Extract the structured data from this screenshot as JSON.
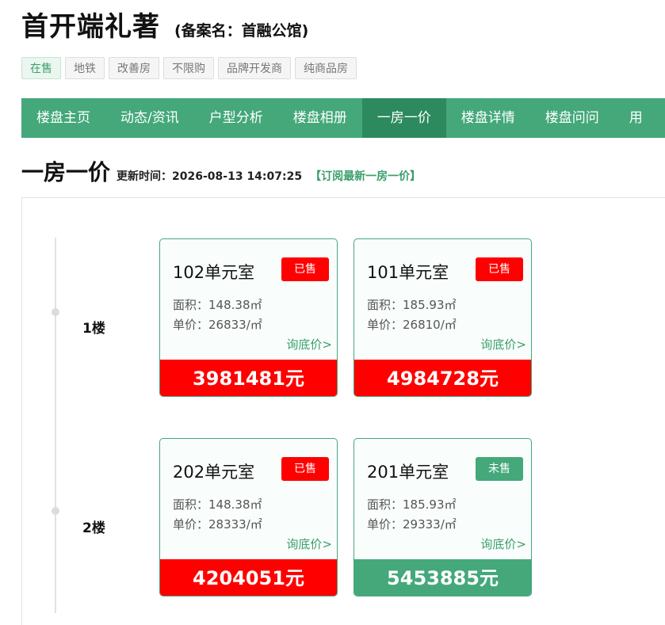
{
  "header": {
    "title": "首开端礼著",
    "record_name": "(备案名：首融公馆)"
  },
  "tags": [
    "在售",
    "地铁",
    "改善房",
    "不限购",
    "品牌开发商",
    "纯商品房"
  ],
  "nav": {
    "items": [
      "楼盘主页",
      "动态/资讯",
      "户型分析",
      "楼盘相册",
      "一房一价",
      "楼盘详情",
      "楼盘问问",
      "用"
    ],
    "active": "一房一价"
  },
  "section": {
    "title": "一房一价",
    "update": "更新时间：2026-08-13 14:07:25",
    "subscribe": "【订阅最新一房一价】"
  },
  "floors": [
    {
      "label": "1楼",
      "units": [
        {
          "name": "102单元室",
          "status": "已售",
          "area": "面积：148.38㎡",
          "unit_price": "单价：26833/㎡",
          "ask": "询底价>",
          "total": "3981481元"
        },
        {
          "name": "101单元室",
          "status": "已售",
          "area": "面积：185.93㎡",
          "unit_price": "单价：26810/㎡",
          "ask": "询底价>",
          "total": "4984728元"
        }
      ]
    },
    {
      "label": "2楼",
      "units": [
        {
          "name": "202单元室",
          "status": "已售",
          "area": "面积：148.38㎡",
          "unit_price": "单价：28333/㎡",
          "ask": "询底价>",
          "total": "4204051元"
        },
        {
          "name": "201单元室",
          "status": "未售",
          "area": "面积：185.93㎡",
          "unit_price": "单价：29333/㎡",
          "ask": "询底价>",
          "total": "5453885元"
        }
      ]
    }
  ],
  "colors": {
    "accent": "#44a87a",
    "accent_dark": "#2d8a5e",
    "sold": "#ff0000"
  }
}
